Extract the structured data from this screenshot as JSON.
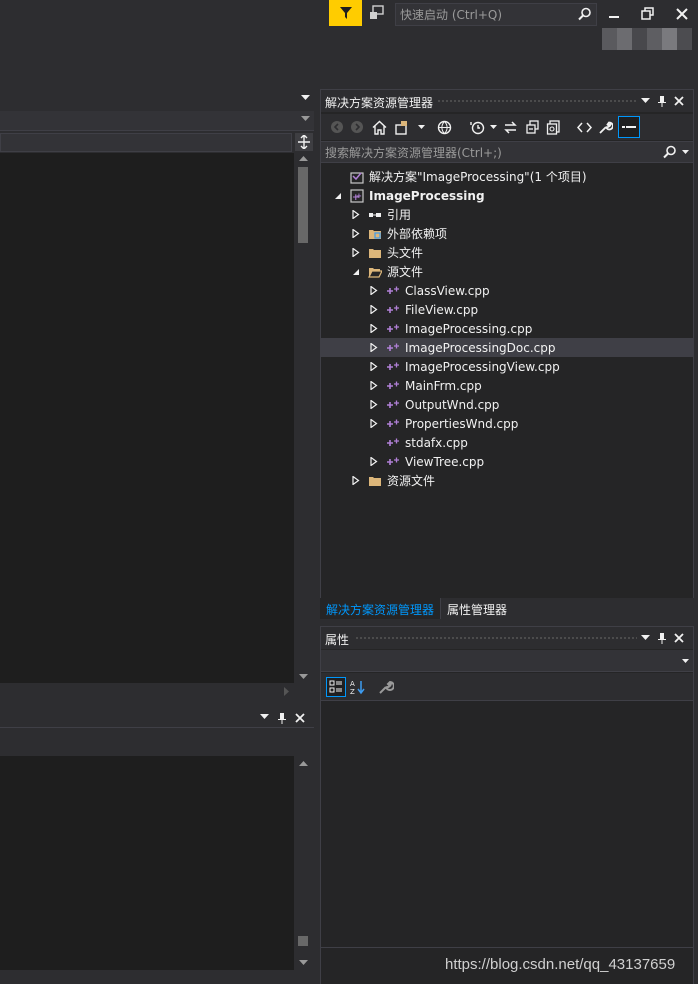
{
  "titlebar": {
    "quick_launch_placeholder": "快速启动 (Ctrl+Q)",
    "colors": {
      "filter_accent": "#ffcc00"
    }
  },
  "solution_explorer": {
    "title": "解决方案资源管理器",
    "search_placeholder": "搜索解决方案资源管理器(Ctrl+;)",
    "tree": [
      {
        "label": "解决方案\"ImageProcessing\"(1 个项目)",
        "icon": "solution-icon",
        "expander": "none"
      },
      {
        "label": "ImageProcessing",
        "icon": "cpp-project-icon",
        "expander": "expanded",
        "bold": true
      },
      {
        "label": "引用",
        "icon": "references-icon",
        "expander": "collapsed"
      },
      {
        "label": "外部依赖项",
        "icon": "external-deps-icon",
        "expander": "collapsed"
      },
      {
        "label": "头文件",
        "icon": "folder-icon",
        "expander": "collapsed"
      },
      {
        "label": "源文件",
        "icon": "folder-open-icon",
        "expander": "expanded"
      },
      {
        "label": "ClassView.cpp",
        "icon": "cpp-file-icon",
        "expander": "collapsed"
      },
      {
        "label": "FileView.cpp",
        "icon": "cpp-file-icon",
        "expander": "collapsed"
      },
      {
        "label": "ImageProcessing.cpp",
        "icon": "cpp-file-icon",
        "expander": "collapsed"
      },
      {
        "label": "ImageProcessingDoc.cpp",
        "icon": "cpp-file-icon",
        "expander": "collapsed",
        "selected": true
      },
      {
        "label": "ImageProcessingView.cpp",
        "icon": "cpp-file-icon",
        "expander": "collapsed"
      },
      {
        "label": "MainFrm.cpp",
        "icon": "cpp-file-icon",
        "expander": "collapsed"
      },
      {
        "label": "OutputWnd.cpp",
        "icon": "cpp-file-icon",
        "expander": "collapsed"
      },
      {
        "label": "PropertiesWnd.cpp",
        "icon": "cpp-file-icon",
        "expander": "collapsed"
      },
      {
        "label": "stdafx.cpp",
        "icon": "cpp-file-icon",
        "expander": "none"
      },
      {
        "label": "ViewTree.cpp",
        "icon": "cpp-file-icon",
        "expander": "collapsed"
      },
      {
        "label": "资源文件",
        "icon": "folder-icon",
        "expander": "collapsed"
      }
    ],
    "tabs": [
      "解决方案资源管理器",
      "属性管理器"
    ],
    "active_tab_color": "#0097fb"
  },
  "properties": {
    "title": "属性"
  },
  "watermark": "https://blog.csdn.net/qq_43137659"
}
